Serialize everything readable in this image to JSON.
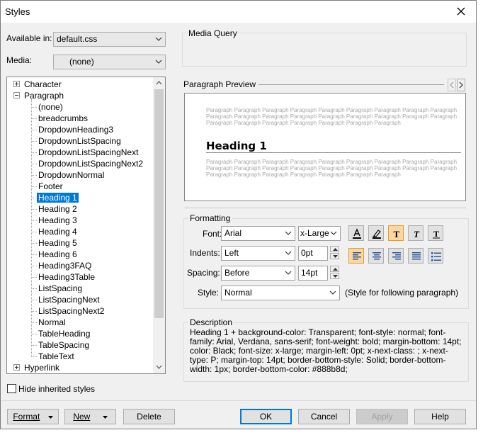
{
  "dialog": {
    "title": "Styles"
  },
  "available_in": {
    "label": "Available in:",
    "value": "default.css"
  },
  "media": {
    "label": "Media:",
    "value": "(none)"
  },
  "media_query": {
    "label": "Media Query"
  },
  "tree": {
    "items": [
      {
        "label": "Character"
      },
      {
        "label": "Paragraph"
      },
      {
        "label": "(none)"
      },
      {
        "label": "breadcrumbs"
      },
      {
        "label": "DropdownHeading3"
      },
      {
        "label": "DropdownListSpacing"
      },
      {
        "label": "DropdownListSpacingNext"
      },
      {
        "label": "DropdownListSpacingNext2"
      },
      {
        "label": "DropdownNormal"
      },
      {
        "label": "Footer"
      },
      {
        "label": "Heading 1"
      },
      {
        "label": "Heading 2"
      },
      {
        "label": "Heading 3"
      },
      {
        "label": "Heading 4"
      },
      {
        "label": "Heading 5"
      },
      {
        "label": "Heading 6"
      },
      {
        "label": "Heading3FAQ"
      },
      {
        "label": "Heading3Table"
      },
      {
        "label": "ListSpacing"
      },
      {
        "label": "ListSpacingNext"
      },
      {
        "label": "ListSpacingNext2"
      },
      {
        "label": "Normal"
      },
      {
        "label": "TableHeading"
      },
      {
        "label": "TableSpacing"
      },
      {
        "label": "TableText"
      },
      {
        "label": "Hyperlink"
      }
    ],
    "selected": "Heading 1"
  },
  "hide_inherited": {
    "label": "Hide inherited styles",
    "checked": false
  },
  "preview": {
    "label": "Paragraph Preview",
    "filler": "Paragraph Paragraph Paragraph Paragraph Paragraph Paragraph Paragraph Paragraph Paragraph Paragraph Paragraph Paragraph Paragraph Paragraph Paragraph Paragraph Paragraph Paragraph Paragraph Paragraph Paragraph Paragraph Paragraph Paragraph Paragraph",
    "heading": "Heading 1"
  },
  "formatting": {
    "label": "Formatting",
    "font_label": "Font:",
    "font_value": "Arial",
    "size_value": "x-Large",
    "indents_label": "Indents:",
    "indents_value": "Left",
    "indent_amount": "0pt",
    "spacing_label": "Spacing:",
    "spacing_value": "Before",
    "spacing_amount": "14pt",
    "style_label": "Style:",
    "style_value": "Normal",
    "style_note": "(Style for following paragraph)"
  },
  "description": {
    "label": "Description",
    "text": "Heading 1 + background-color: Transparent; font-style: normal; font-family: Arial, Verdana, sans-serif; font-weight: bold; margin-bottom: 14pt; color: Black; font-size: x-large; margin-left: 0pt; x-next-class: ; x-next-type: P; margin-top: 14pt; border-bottom-style: Solid; border-bottom-width: 1px; border-bottom-color: #888b8d;"
  },
  "buttons": {
    "format": "Format",
    "new": "New",
    "delete": "Delete",
    "ok": "OK",
    "cancel": "Cancel",
    "apply": "Apply",
    "help": "Help"
  },
  "colors": {
    "selection": "#0078d7",
    "toggle_on": "#fad7a0"
  }
}
